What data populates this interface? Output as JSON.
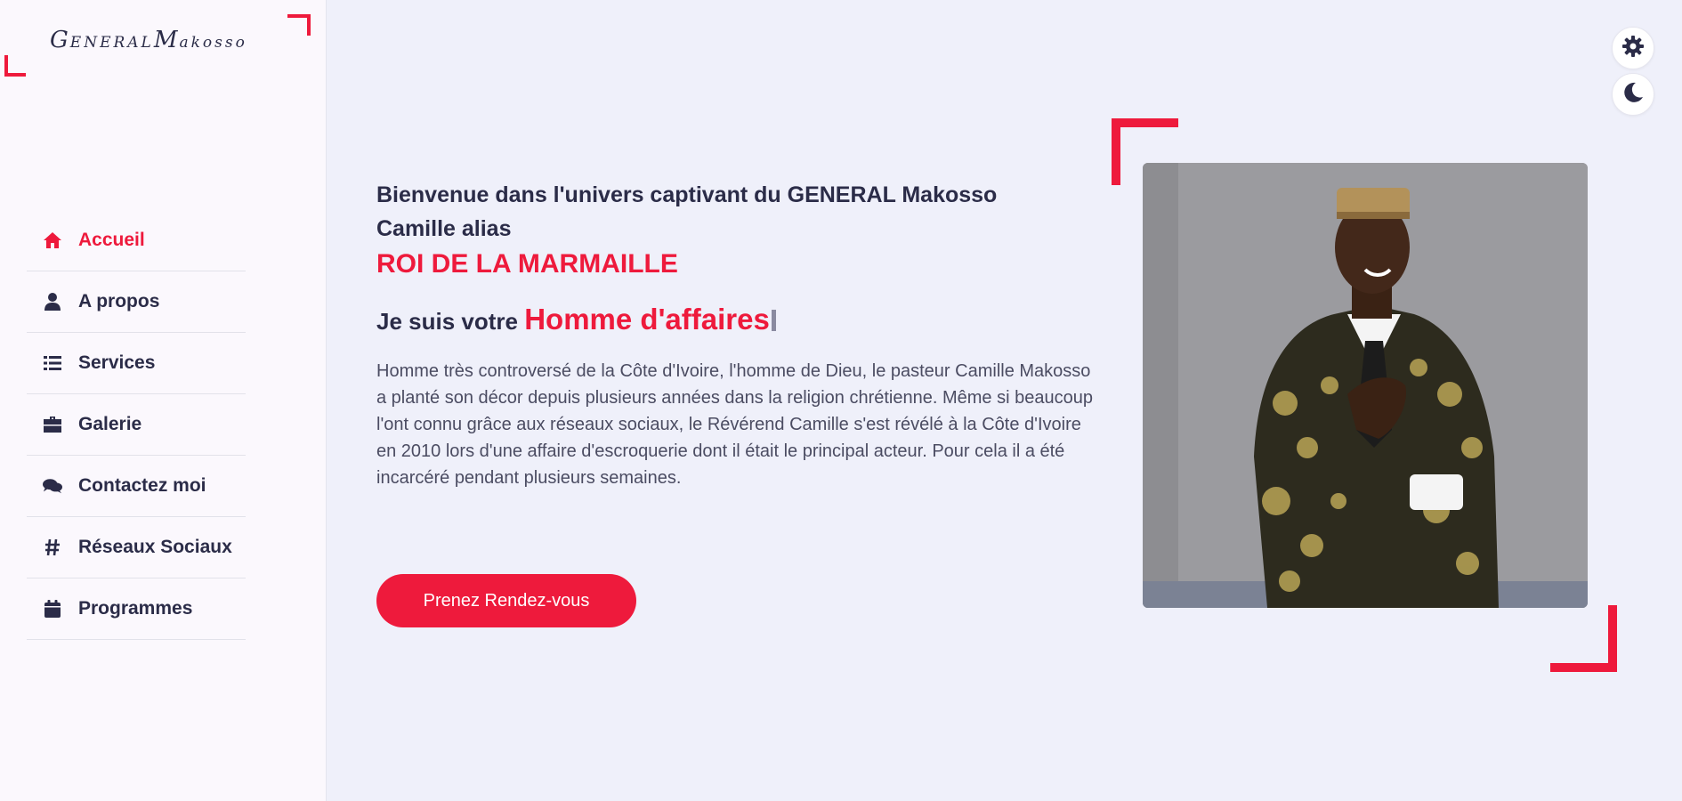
{
  "brand": {
    "logo_part1": "G",
    "logo_part2": "ENERAL",
    "logo_part3": "M",
    "logo_part4": "akosso"
  },
  "sidebar": {
    "items": [
      {
        "label": "Accueil",
        "icon": "home-icon",
        "active": true
      },
      {
        "label": "A propos",
        "icon": "user-icon",
        "active": false
      },
      {
        "label": "Services",
        "icon": "list-icon",
        "active": false
      },
      {
        "label": "Galerie",
        "icon": "briefcase-icon",
        "active": false
      },
      {
        "label": "Contactez moi",
        "icon": "comments-icon",
        "active": false
      },
      {
        "label": "Réseaux Sociaux",
        "icon": "hashtag-icon",
        "active": false
      },
      {
        "label": "Programmes",
        "icon": "calendar-icon",
        "active": false
      }
    ]
  },
  "controls": {
    "settings_icon": "gear-icon",
    "theme_icon": "moon-icon"
  },
  "hero": {
    "welcome": "Bienvenue dans l'univers captivant du GENERAL Makosso Camille alias",
    "alias": "ROI DE LA MARMAILLE",
    "role_prefix": "Je suis votre",
    "role": "Homme d'affaires",
    "bio": "Homme très controversé de la Côte d'Ivoire, l'homme de Dieu, le pasteur Camille Makosso a planté son décor depuis plusieurs années dans la religion chrétienne. Même si beaucoup l'ont connu grâce aux réseaux sociaux, le Révérend Camille s'est révélé à la Côte d'Ivoire en 2010 lors d'une affaire d'escroquerie dont il était le principal acteur. Pour cela il a été incarcéré pendant plusieurs semaines.",
    "cta_label": "Prenez Rendez-vous"
  },
  "colors": {
    "accent": "#ee1a3c",
    "text": "#2b2c48",
    "background": "#eff0fa",
    "sidebar": "#fbf8fd"
  }
}
